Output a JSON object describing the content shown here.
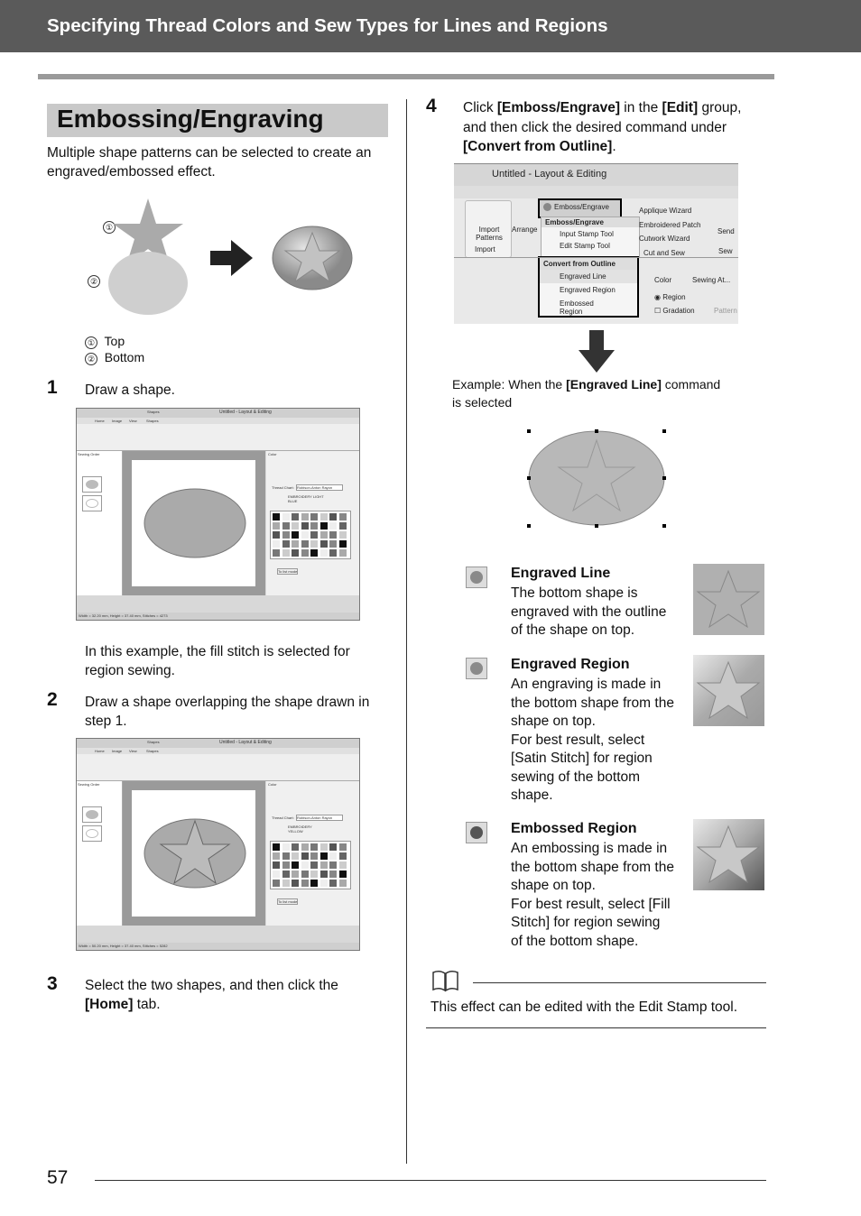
{
  "header": {
    "title": "Specifying Thread Colors and Sew Types for Lines and Regions"
  },
  "section": {
    "title": "Embossing/Engraving",
    "intro": "Multiple shape patterns can be selected to create an engraved/embossed effect."
  },
  "figure": {
    "markers": [
      "①",
      "②"
    ],
    "legend": [
      {
        "num": "①",
        "label": "Top"
      },
      {
        "num": "②",
        "label": "Bottom"
      }
    ]
  },
  "steps": [
    {
      "num": "1",
      "text": "Draw a shape.",
      "note": "In this example, the fill stitch is selected for region sewing."
    },
    {
      "num": "2",
      "text": "Draw a shape overlapping the shape drawn in step 1."
    },
    {
      "num": "3",
      "text_pre": "Select the two shapes, and then click the ",
      "text_bold": "[Home]",
      "text_post": " tab."
    },
    {
      "num": "4",
      "l1a": "Click ",
      "l1b": "[Emboss/Engrave]",
      "l1c": " in the ",
      "l1d": "[Edit]",
      "l1e": " group,",
      "l2": "and then click the desired command under",
      "l3": "[Convert from Outline]",
      "l3e": "."
    }
  ],
  "app": {
    "window_title": "Untitled - Layout & Editing",
    "context_tab": "Shapes",
    "tabs": [
      "Home",
      "Image",
      "View",
      "Shapes"
    ],
    "status": "Width = 32.20 mm, Height = 37.40 mm, Stitches = 4273",
    "status2": "Width = 50.20 mm, Height = 37.40 mm, Stitches = 5282",
    "panel_sewing_order": "Sewing Order",
    "panel_color": "Color",
    "thread_chart_label": "Thread Chart:",
    "thread_chart_value": "Robison-Anton Rayon",
    "thread1": "EMBROIDERY LIGHT BLUE",
    "thread2": "EMBROIDERY YELLOW",
    "line": "Line",
    "region": "Region",
    "gradation": "Gradation",
    "pattern": "Pattern",
    "to_list": "To list mode",
    "ribbon": {
      "emboss_btn": "Emboss/Engrave",
      "applique": "Applique Wizard",
      "patch": "Embroidered Patch",
      "cutwork": "Cutwork Wizard",
      "cut_sew": "Cut and Sew",
      "import": "Import Patterns",
      "import_grp": "Import",
      "arrange": "Arrange",
      "send": "Send",
      "sew": "Sew",
      "menu_header": "Emboss/Engrave",
      "input_stamp": "Input Stamp Tool",
      "edit_stamp": "Edit Stamp Tool",
      "convert_header": "Convert from Outline",
      "engraved_line": "Engraved Line",
      "engraved_region": "Engraved Region",
      "embossed_region": "Embossed Region",
      "color_tab": "Color",
      "sewing_tab": "Sewing At..."
    }
  },
  "example": {
    "pre": "Example: When the ",
    "bold": "[Engraved Line]",
    "post": " command",
    "line2": "is selected"
  },
  "effects": [
    {
      "title": "Engraved Line",
      "desc": [
        "The bottom shape is",
        "engraved with the outline",
        "of the shape on top."
      ],
      "icon": "engraved-line-icon",
      "color": "#8a8a8a"
    },
    {
      "title": "Engraved Region",
      "desc": [
        "An engraving is made in",
        "the bottom shape from the",
        "shape on top.",
        "For best result, select",
        "[Satin Stitch] for region",
        "sewing of the bottom",
        "shape."
      ],
      "icon": "engraved-region-icon",
      "color": "#8a8a8a"
    },
    {
      "title": "Embossed Region",
      "desc": [
        "An embossing is made in",
        "the bottom shape from the",
        "shape on top.",
        "For best result, select [Fill",
        "Stitch] for region sewing",
        "of the bottom shape."
      ],
      "icon": "embossed-region-icon",
      "color": "#555555"
    }
  ],
  "memo": {
    "icon": "book-icon",
    "text": "This effect can be edited with the Edit Stamp tool."
  },
  "footer": {
    "page": "57"
  }
}
